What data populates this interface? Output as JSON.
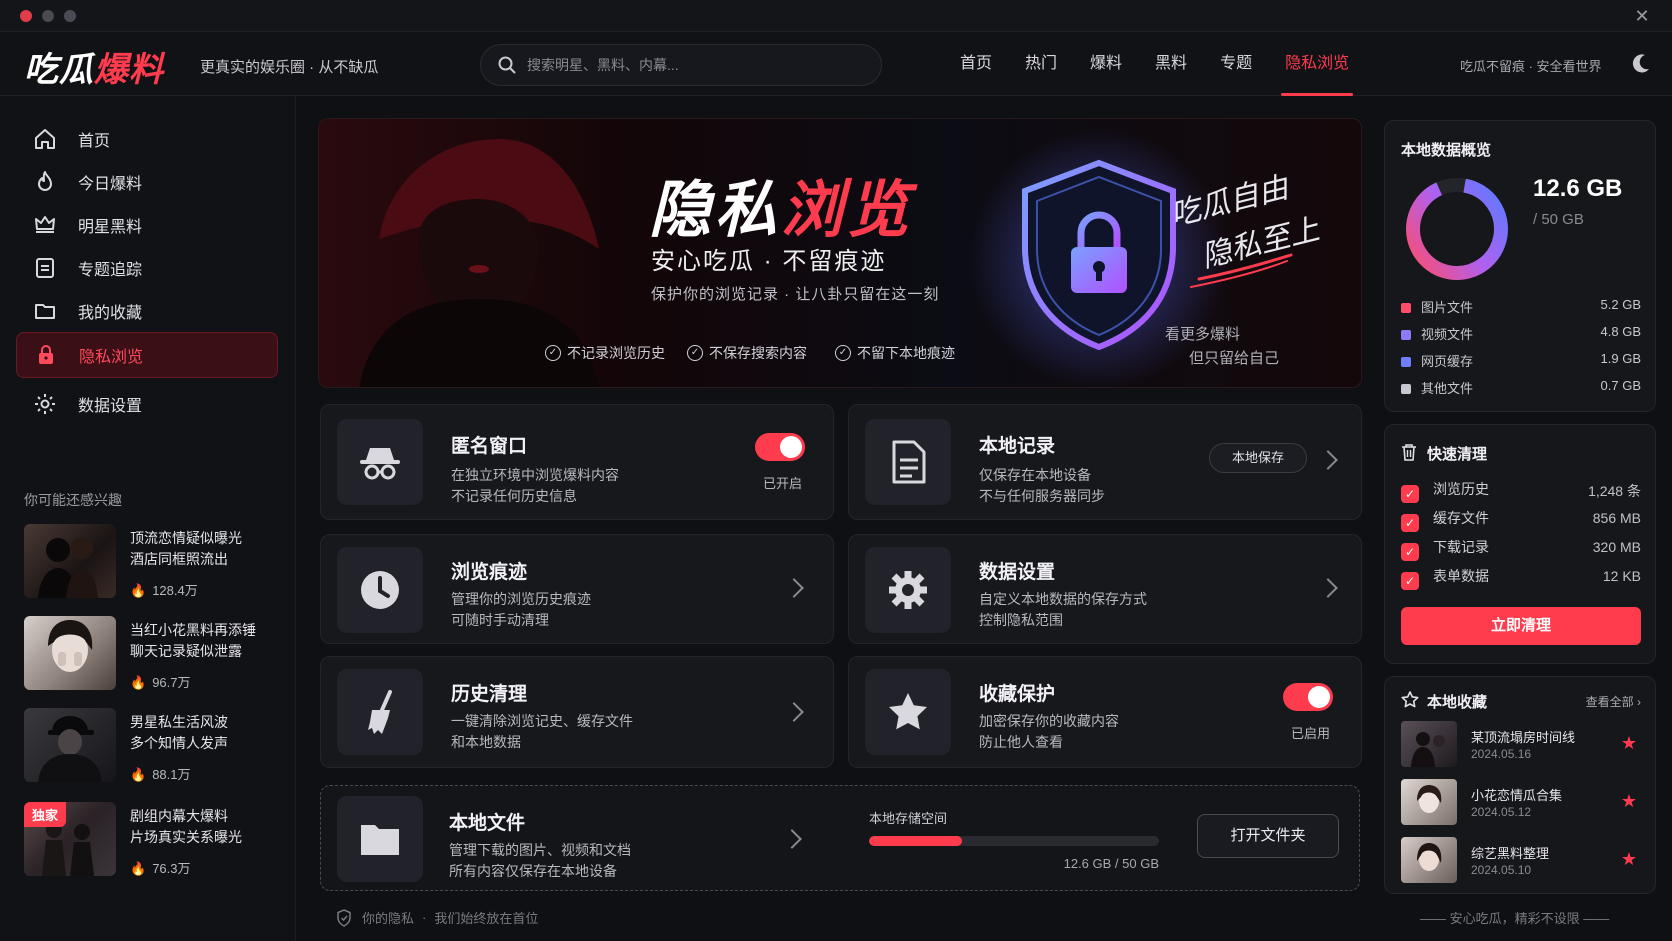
{
  "window": {
    "close_icon": "close-icon"
  },
  "topbar": {
    "logo_white": "吃瓜",
    "logo_red": "爆料",
    "slogan": "更真实的娱乐圈 · 从不缺瓜",
    "search_placeholder": "搜索明星、黑料、内幕...",
    "nav": [
      "首页",
      "热门",
      "爆料",
      "黑料",
      "专题",
      "隐私浏览"
    ],
    "active_nav": "隐私浏览",
    "right_text": "吃瓜不留痕 · 安全看世界"
  },
  "sidebar": {
    "items": [
      {
        "label": "首页",
        "icon": "home-icon"
      },
      {
        "label": "今日爆料",
        "icon": "fire-icon"
      },
      {
        "label": "明星黑料",
        "icon": "crown-icon"
      },
      {
        "label": "专题追踪",
        "icon": "document-icon"
      },
      {
        "label": "我的收藏",
        "icon": "folder-icon"
      },
      {
        "label": "隐私浏览",
        "icon": "lock-icon",
        "active": true
      },
      {
        "label": "数据设置",
        "icon": "gear-icon"
      }
    ],
    "interest_title": "你可能还感兴趣",
    "feed": [
      {
        "line1": "顶流恋情疑似曝光",
        "line2": "酒店同框照流出",
        "hot": "128.4万"
      },
      {
        "line1": "当红小花黑料再添锤",
        "line2": "聊天记录疑似泄露",
        "hot": "96.7万"
      },
      {
        "line1": "男星私生活风波",
        "line2": "多个知情人发声",
        "hot": "88.1万"
      },
      {
        "line1": "剧组内幕大爆料",
        "line2": "片场真实关系曝光",
        "hot": "76.3万",
        "badge": "独家"
      }
    ]
  },
  "hero": {
    "title_white": "隐私",
    "title_red": "浏览",
    "subtitle": "安心吃瓜 · 不留痕迹",
    "desc": "保护你的浏览记录 · 让八卦只留在这一刻",
    "checks": [
      "不记录浏览历史",
      "不保存搜索内容",
      "不留下本地痕迹"
    ],
    "hand_line1": "吃瓜自由",
    "hand_line2": "隐私至上",
    "side_line1": "看更多爆料",
    "side_line2": "但只留给自己"
  },
  "cards": {
    "incognito": {
      "title": "匿名窗口",
      "desc1": "在独立环境中浏览爆料内容",
      "desc2": "不记录任何历史信息",
      "status": "已开启"
    },
    "local": {
      "title": "本地记录",
      "desc1": "仅保存在本地设备",
      "desc2": "不与任何服务器同步",
      "pill": "本地保存"
    },
    "trace": {
      "title": "浏览痕迹",
      "desc1": "管理你的浏览历史痕迹",
      "desc2": "可随时手动清理"
    },
    "settings": {
      "title": "数据设置",
      "desc1": "自定义本地数据的保存方式",
      "desc2": "控制隐私范围"
    },
    "history": {
      "title": "历史清理",
      "desc1": "一键清除浏览记史、缓存文件",
      "desc2": "和本地数据"
    },
    "favprotect": {
      "title": "收藏保护",
      "desc1": "加密保存你的收藏内容",
      "desc2": "防止他人查看",
      "status": "已启用"
    },
    "files": {
      "title": "本地文件",
      "desc1": "管理下载的图片、视频和文档",
      "desc2": "所有内容仅保存在本地设备",
      "storage_label": "本地存储空间",
      "storage_text": "12.6 GB / 50 GB",
      "storage_fraction": 0.32,
      "open_button": "打开文件夹"
    }
  },
  "footer": {
    "left1": "你的隐私",
    "left2": "我们始终放在首位",
    "right": "—— 安心吃瓜，精彩不设限 ——"
  },
  "overview": {
    "title": "本地数据概览",
    "used": "12.6 GB",
    "total": "/ 50 GB",
    "items": [
      {
        "label": "图片文件",
        "value": "5.2 GB",
        "color": "#ff4d6a"
      },
      {
        "label": "视频文件",
        "value": "4.8 GB",
        "color": "#8b7cf6"
      },
      {
        "label": "网页缓存",
        "value": "1.9 GB",
        "color": "#6f7dff"
      },
      {
        "label": "其他文件",
        "value": "0.7 GB",
        "color": "#c8c8d0"
      }
    ]
  },
  "quickclean": {
    "title": "快速清理",
    "items": [
      {
        "label": "浏览历史",
        "value": "1,248 条"
      },
      {
        "label": "缓存文件",
        "value": "856 MB"
      },
      {
        "label": "下载记录",
        "value": "320 MB"
      },
      {
        "label": "表单数据",
        "value": "12 KB"
      }
    ],
    "button": "立即清理"
  },
  "favorites": {
    "title": "本地收藏",
    "view_all": "查看全部 ›",
    "items": [
      {
        "title": "某顶流塌房时间线",
        "date": "2024.05.16"
      },
      {
        "title": "小花恋情瓜合集",
        "date": "2024.05.12"
      },
      {
        "title": "综艺黑料整理",
        "date": "2024.05.10"
      }
    ]
  }
}
